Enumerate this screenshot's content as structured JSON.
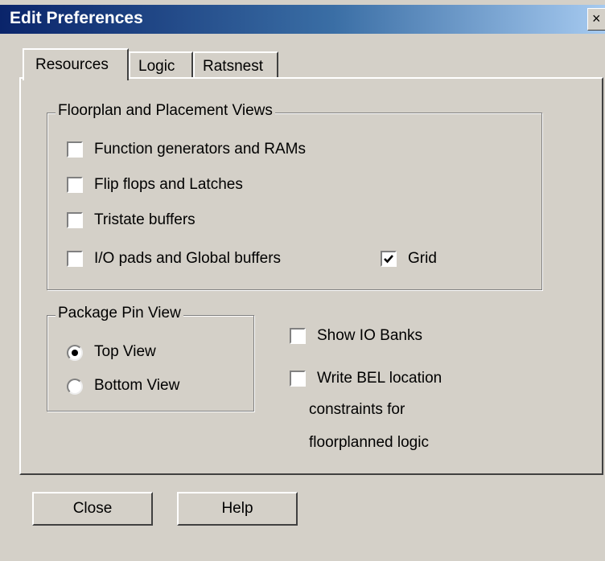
{
  "window": {
    "title": "Edit Preferences",
    "close_glyph": "×"
  },
  "tabs": [
    {
      "label": "Resources",
      "selected": true
    },
    {
      "label": "Logic",
      "selected": false
    },
    {
      "label": "Ratsnest",
      "selected": false
    }
  ],
  "floorplan": {
    "legend": "Floorplan and Placement Views",
    "options": [
      {
        "label": "Function generators and RAMs",
        "checked": false
      },
      {
        "label": "Flip flops and Latches",
        "checked": false
      },
      {
        "label": "Tristate buffers",
        "checked": false
      },
      {
        "label": "I/O pads and Global buffers",
        "checked": false
      }
    ],
    "grid": {
      "label": "Grid",
      "checked": true
    }
  },
  "package_pin_view": {
    "legend": "Package Pin View",
    "options": [
      {
        "label": "Top View",
        "selected": true
      },
      {
        "label": "Bottom View",
        "selected": false
      }
    ]
  },
  "show_io_banks": {
    "label": "Show IO Banks",
    "checked": false
  },
  "write_bel": {
    "label": "Write BEL location",
    "line2": "constraints for",
    "line3": "floorplanned logic",
    "checked": false
  },
  "buttons": {
    "close": "Close",
    "help": "Help"
  }
}
